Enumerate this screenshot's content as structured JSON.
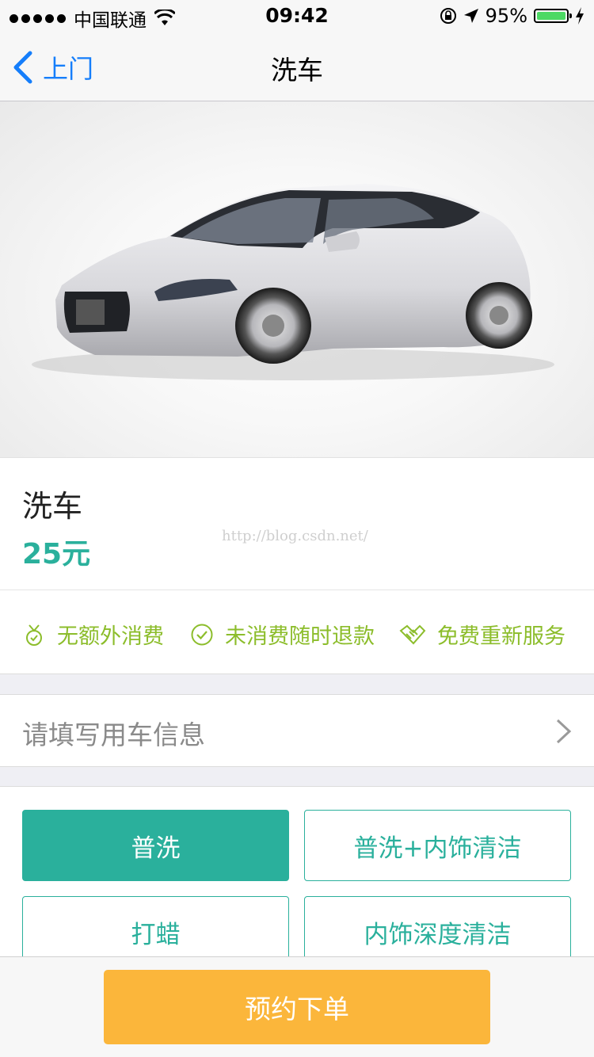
{
  "status_bar": {
    "carrier": "中国联通",
    "time": "09:42",
    "battery": "95%",
    "battery_level": 0.95,
    "signal_bars": 5
  },
  "nav": {
    "back_label": "上门",
    "title": "洗车"
  },
  "hero": {
    "image": "car-photo"
  },
  "product": {
    "name": "洗车",
    "price": "25元",
    "watermark": "http://blog.csdn.net/"
  },
  "guarantees": [
    {
      "icon": "medal-icon",
      "label": "无额外消费"
    },
    {
      "icon": "check-circle-icon",
      "label": "未消费随时退款"
    },
    {
      "icon": "handshake-icon",
      "label": "免费重新服务"
    }
  ],
  "vehicle_info": {
    "placeholder": "请填写用车信息",
    "icon": "chevron-right-icon"
  },
  "service_options": [
    {
      "label": "普洗",
      "selected": true
    },
    {
      "label": "普洗+内饰清洁",
      "selected": false
    },
    {
      "label": "打蜡",
      "selected": false
    },
    {
      "label": "内饰深度清洁",
      "selected": false
    }
  ],
  "order_button": {
    "label": "预约下单"
  },
  "colors": {
    "accent_teal": "#2ab09c",
    "guarantee_green": "#8cbd2b",
    "order_orange": "#fbb63b",
    "ios_blue": "#157efb"
  }
}
